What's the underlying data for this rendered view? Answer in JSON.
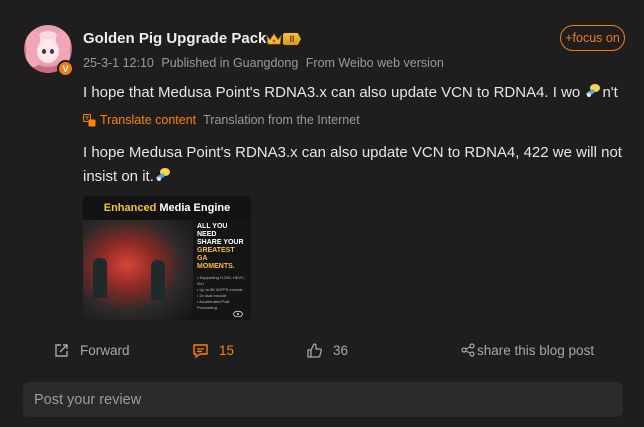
{
  "author": {
    "name": "Golden Pig Upgrade Pack",
    "verified_badge": "V",
    "level_badge": "II",
    "avatar_icon": "anime-girl-avatar"
  },
  "meta": {
    "datetime": "25-3-1 12:10",
    "location": "Published in Guangdong",
    "source": "From Weibo web version"
  },
  "follow_label": "+focus on",
  "post": {
    "text": "I hope that Medusa Point's RDNA3.x can also update VCN to RDNA4. I wo ",
    "text_tail": "n't"
  },
  "translate": {
    "link_label": "Translate content",
    "source_label": "Translation from the Internet"
  },
  "translation": {
    "text": "I hope Medusa Point's RDNA3.x can also update VCN to RDNA4, 422 we will not insist on it."
  },
  "image": {
    "banner_prefix": "Enhanced",
    "banner_rest": "Media Engine",
    "panel_line1": "ALL YOU NEED",
    "panel_line2": "SHARE YOUR",
    "panel_line3": "GREATEST GA",
    "panel_line4": "MOMENTS.",
    "bullet1": "• Supporting H.264, HEVC, AV1",
    "bullet2": "• Up to 8K 60FPS encode",
    "bullet3": "• 2x dual encode",
    "bullet4": "• Accelerated Post Processing"
  },
  "actions": {
    "forward_label": "Forward",
    "comment_count": "15",
    "like_count": "36",
    "share_label": "share this blog post"
  },
  "review": {
    "placeholder": "Post your review"
  },
  "colors": {
    "accent": "#ff8200",
    "background": "#1e1e1e",
    "input_bg": "#2b2b2b"
  }
}
